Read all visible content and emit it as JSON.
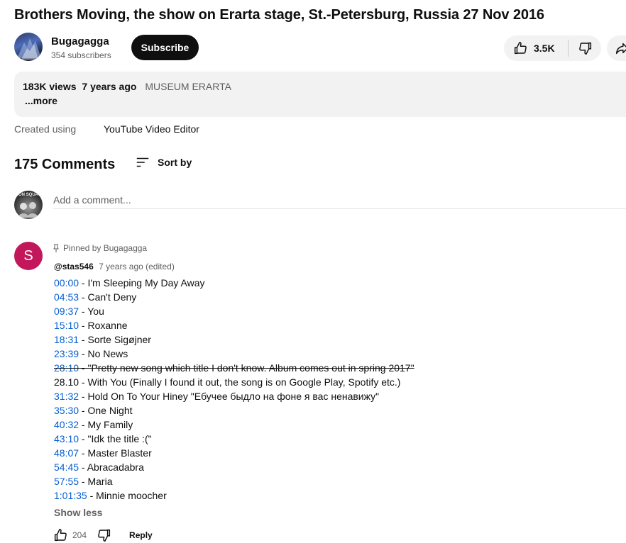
{
  "video": {
    "title": "Brothers Moving, the show on Erarta stage, St.-Petersburg, Russia 27 Nov 2016"
  },
  "channel": {
    "name": "Bugagagga",
    "subscribers": "354 subscribers",
    "subscribe_label": "Subscribe"
  },
  "actions": {
    "likes": "3.5K",
    "like_icon": "thumbs-up-icon",
    "dislike_icon": "thumbs-down-icon",
    "share_icon": "share-icon"
  },
  "description": {
    "views": "183K views",
    "age": "7 years ago",
    "location": "MUSEUM ERARTA",
    "more": "...more"
  },
  "created": {
    "label": "Created using",
    "value": "YouTube Video Editor"
  },
  "comments": {
    "count": "175 Comments",
    "sort_label": "Sort by",
    "add_placeholder": "Add a comment...",
    "my_avatar_text": "ON SQUA"
  },
  "pinned_comment": {
    "pinned_label": "Pinned by Bugagagga",
    "avatar_letter": "S",
    "author": "@stas546",
    "meta": "7 years ago (edited)",
    "tracks": [
      {
        "ts": "00:00",
        "text": " - I'm Sleeping My Day Away"
      },
      {
        "ts": "04:53",
        "text": " - Can't Deny"
      },
      {
        "ts": "09:37",
        "text": " - You"
      },
      {
        "ts": "15:10",
        "text": " - Roxanne"
      },
      {
        "ts": "18:31",
        "text": " - Sorte Sigøjner"
      },
      {
        "ts": "23:39",
        "text": " - No News"
      },
      {
        "ts": "28:10",
        "text": " - \"Pretty new song which title I don't know. Album comes out in spring 2017\"",
        "strike": true
      },
      {
        "ts": "",
        "text": "28.10 - With You (Finally I found it out, the song is on Google Play, Spotify etc.)"
      },
      {
        "ts": "31:32",
        "text": " - Hold On To Your Hiney \"Ебучее быдло на фоне я вас ненавижу\""
      },
      {
        "ts": "35:30",
        "text": " - One Night"
      },
      {
        "ts": "40:32",
        "text": " - My Family"
      },
      {
        "ts": "43:10",
        "text": " - \"Idk the title :(\""
      },
      {
        "ts": "48:07",
        "text": " - Master Blaster"
      },
      {
        "ts": "54:45",
        "text": " - Abracadabra"
      },
      {
        "ts": "57:55",
        "text": " - Maria"
      },
      {
        "ts": "1:01:35",
        "text": " - Minnie moocher"
      }
    ],
    "show_less": "Show less",
    "likes": "204",
    "reply": "Reply"
  }
}
